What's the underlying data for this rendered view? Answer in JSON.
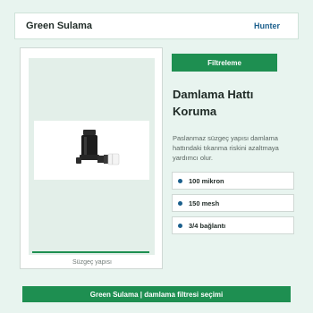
{
  "header": {
    "brand": "Green Sulama",
    "link": "Hunter"
  },
  "product": {
    "image_caption": "Süzgeç yapısı",
    "filter_tab": "Filtreleme",
    "title": "Damlama Hattı Koruma",
    "description": "Paslanmaz süzgeç yapısı damlama hattındaki tıkanma riskini azaltmaya yardımcı olur.",
    "image_icon": "drip-filter-valve",
    "specs": [
      {
        "label": "100 mikron"
      },
      {
        "label": "150 mesh"
      },
      {
        "label": "3/4 bağlantı"
      }
    ]
  },
  "footer": {
    "text": "Green Sulama | damlama filtresi seçimi"
  },
  "colors": {
    "accent": "#1e8f51",
    "link": "#1b5f8c",
    "background": "#e8f4ef"
  }
}
